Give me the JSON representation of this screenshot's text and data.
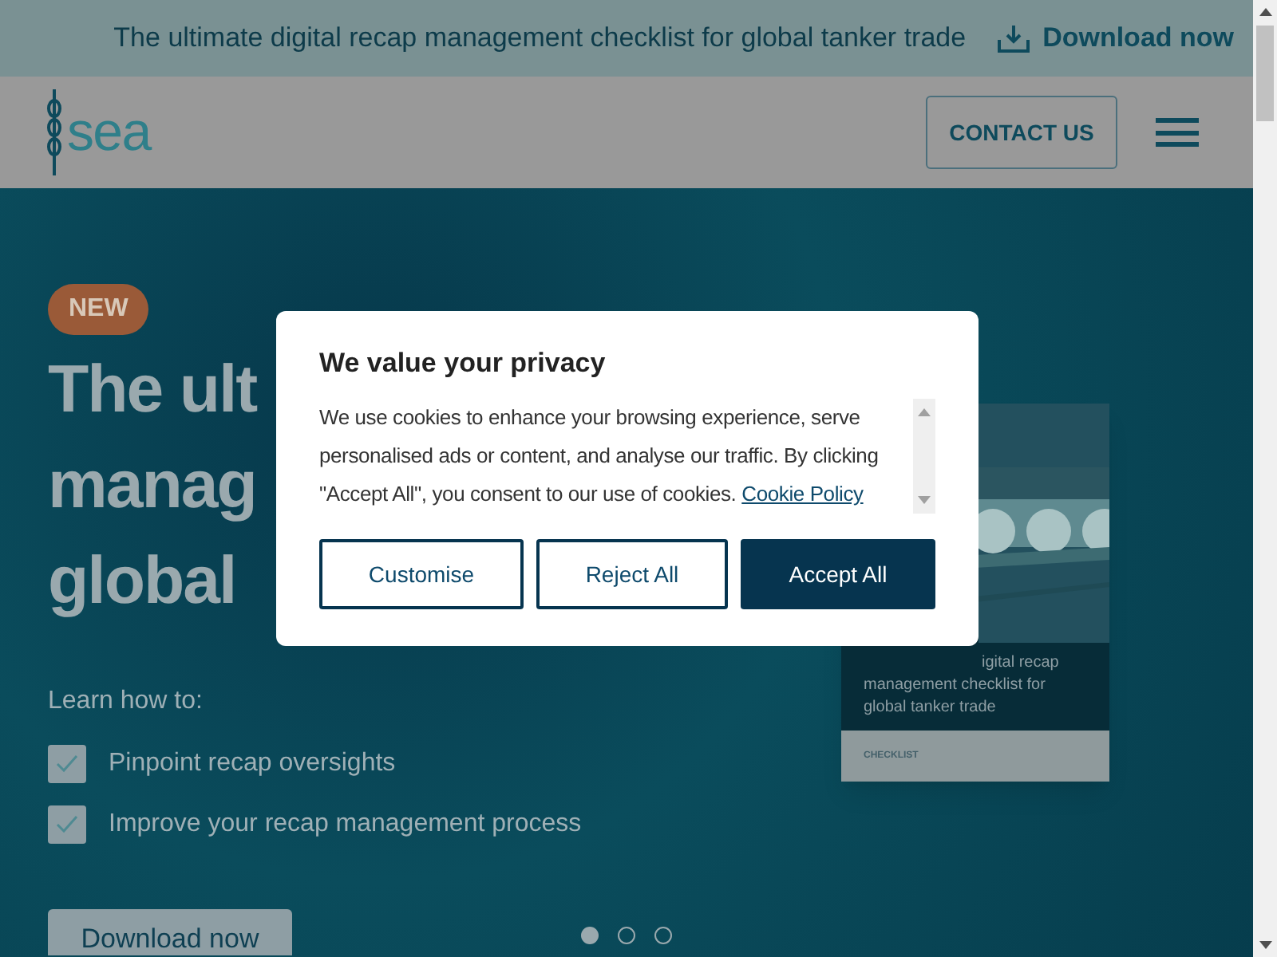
{
  "banner": {
    "text": "The ultimate digital recap management checklist for global tanker trade",
    "link": "Download now"
  },
  "header": {
    "logo": "sea",
    "contact_button": "CONTACT US"
  },
  "hero": {
    "badge": "NEW",
    "headline": [
      "The ult",
      "manag",
      "global"
    ],
    "intro": "Learn how to:",
    "points": [
      {
        "text": "Pinpoint recap oversights",
        "checked": true
      },
      {
        "text": "Improve your recap management process",
        "checked": true
      }
    ],
    "button": "Download now",
    "slides": [
      {
        "selected": true
      },
      {
        "selected": false
      },
      {
        "selected": false
      }
    ]
  },
  "cover": {
    "lines": [
      "igital recap",
      "management checklist for",
      "global tanker trade"
    ],
    "label": "CHECKLIST"
  },
  "cookie_dialog": {
    "title": "We value your privacy",
    "body": "We use cookies to enhance your browsing experience, serve personalised ads or content, and analyse our traffic. By clicking \"Accept All\", you consent to our use of cookies.",
    "link": "Cookie Policy",
    "buttons": [
      {
        "label": "Customise",
        "kind": "outline"
      },
      {
        "label": "Reject All",
        "kind": "outline"
      },
      {
        "label": "Accept All",
        "kind": "filled"
      }
    ]
  }
}
